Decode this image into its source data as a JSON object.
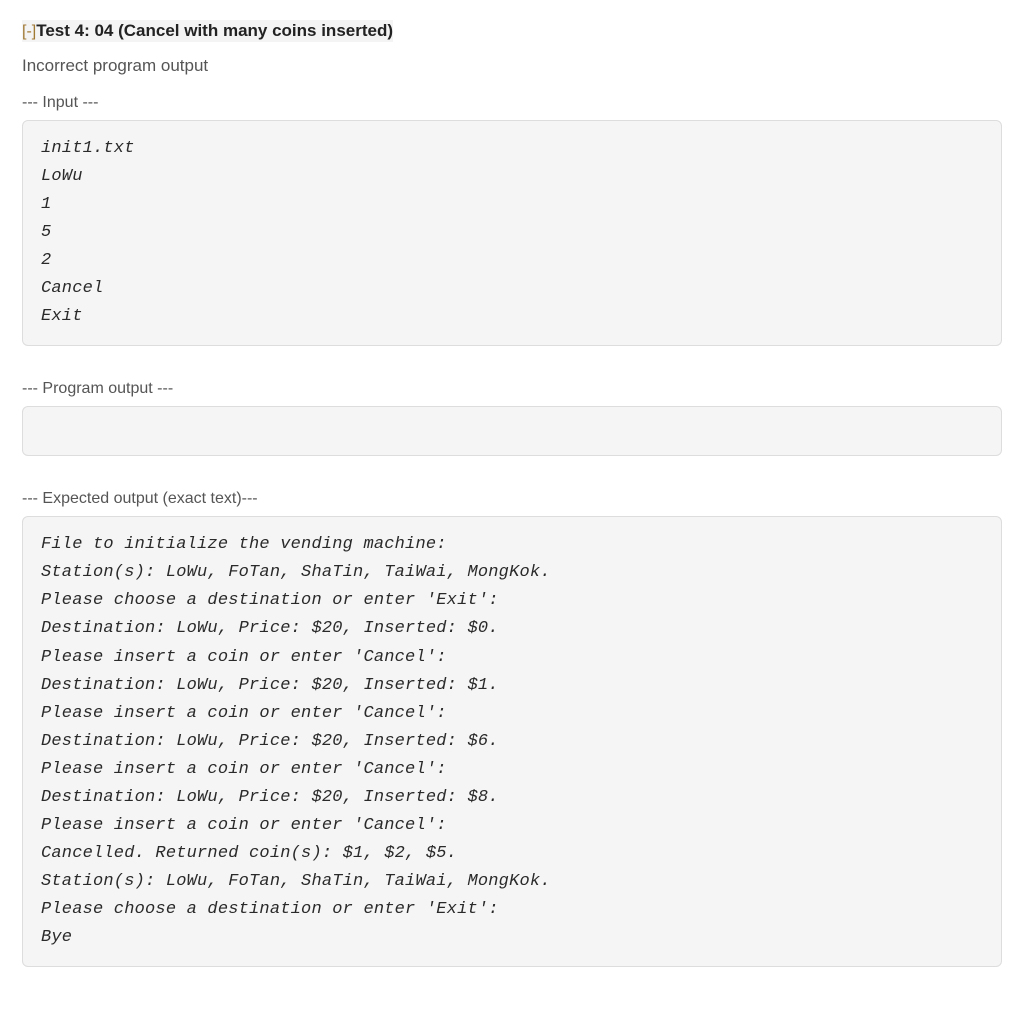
{
  "header": {
    "toggle_prefix": "[-]",
    "title": "Test 4: 04 (Cancel with many coins inserted)"
  },
  "subtitle": "Incorrect program output",
  "sections": {
    "input": {
      "label": "--- Input ---",
      "content": "init1.txt\nLoWu\n1\n5\n2\nCancel\nExit"
    },
    "program_output": {
      "label": "--- Program output ---",
      "content": ""
    },
    "expected_output": {
      "label": "--- Expected output (exact text)---",
      "content": "File to initialize the vending machine:\nStation(s): LoWu, FoTan, ShaTin, TaiWai, MongKok.\nPlease choose a destination or enter 'Exit':\nDestination: LoWu, Price: $20, Inserted: $0.\nPlease insert a coin or enter 'Cancel':\nDestination: LoWu, Price: $20, Inserted: $1.\nPlease insert a coin or enter 'Cancel':\nDestination: LoWu, Price: $20, Inserted: $6.\nPlease insert a coin or enter 'Cancel':\nDestination: LoWu, Price: $20, Inserted: $8.\nPlease insert a coin or enter 'Cancel':\nCancelled. Returned coin(s): $1, $2, $5.\nStation(s): LoWu, FoTan, ShaTin, TaiWai, MongKok.\nPlease choose a destination or enter 'Exit':\nBye"
    }
  }
}
